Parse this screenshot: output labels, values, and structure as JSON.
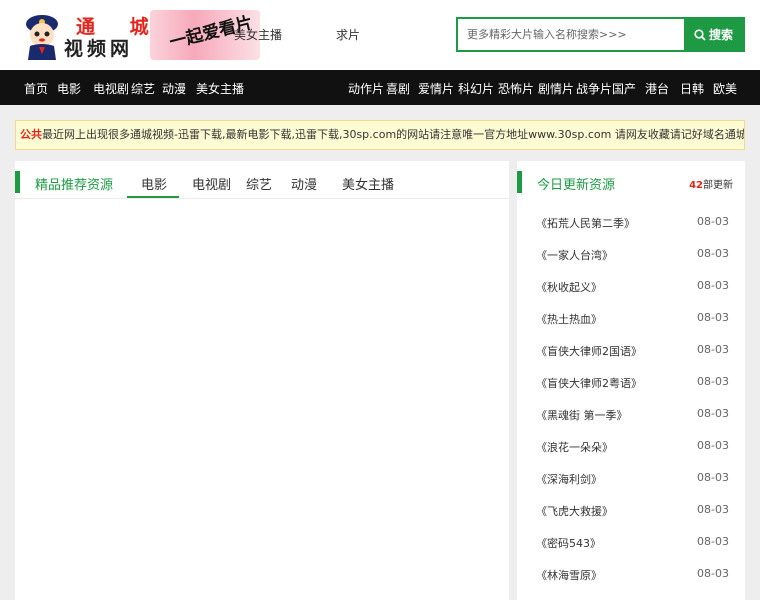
{
  "header": {
    "logo": {
      "line1": "通 城",
      "line2": "视频网",
      "slogan": "一起爱看片"
    },
    "top_links": [
      {
        "label": "美女主播"
      },
      {
        "label": "求片"
      }
    ],
    "search": {
      "placeholder": "更多精彩大片输入名称搜索>>>",
      "button_label": "搜索"
    }
  },
  "nav": {
    "items": [
      {
        "label": "首页"
      },
      {
        "label": "电影"
      },
      {
        "label": "电视剧"
      },
      {
        "label": "综艺"
      },
      {
        "label": "动漫"
      },
      {
        "label": "美女主播"
      },
      {
        "label": "动作片"
      },
      {
        "label": "喜剧"
      },
      {
        "label": "爱情片"
      },
      {
        "label": "科幻片"
      },
      {
        "label": "恐怖片"
      },
      {
        "label": "剧情片"
      },
      {
        "label": "战争片"
      },
      {
        "label": "国产"
      },
      {
        "label": "港台"
      },
      {
        "label": "日韩"
      },
      {
        "label": "欧美"
      }
    ]
  },
  "notice": {
    "label": "公共",
    "text": "最近网上出现很多通城视频-迅雷下载,最新电影下载,迅雷下载,30sp.com的网站请注意唯一官方地址www.30sp.com 请网友收藏请记好域名通城视频-迅雷"
  },
  "left_panel": {
    "title": "精品推荐资源",
    "tabs": [
      {
        "label": "电影"
      },
      {
        "label": "电视剧"
      },
      {
        "label": "综艺"
      },
      {
        "label": "动漫"
      },
      {
        "label": "美女主播"
      }
    ],
    "active_tab": "电影"
  },
  "right_panel": {
    "title": "今日更新资源",
    "count": "42",
    "count_suffix": "部更新",
    "items": [
      {
        "title": "《拓荒人民第二季》",
        "date": "08-03"
      },
      {
        "title": "《一家人台湾》",
        "date": "08-03"
      },
      {
        "title": "《秋收起义》",
        "date": "08-03"
      },
      {
        "title": "《热土热血》",
        "date": "08-03"
      },
      {
        "title": "《盲侠大律师2国语》",
        "date": "08-03"
      },
      {
        "title": "《盲侠大律师2粤语》",
        "date": "08-03"
      },
      {
        "title": "《黑魂街 第一季》",
        "date": "08-03"
      },
      {
        "title": "《浪花一朵朵》",
        "date": "08-03"
      },
      {
        "title": "《深海利剑》",
        "date": "08-03"
      },
      {
        "title": "《飞虎大救援》",
        "date": "08-03"
      },
      {
        "title": "《密码543》",
        "date": "08-03"
      },
      {
        "title": "《林海雪原》",
        "date": "08-03"
      }
    ]
  }
}
